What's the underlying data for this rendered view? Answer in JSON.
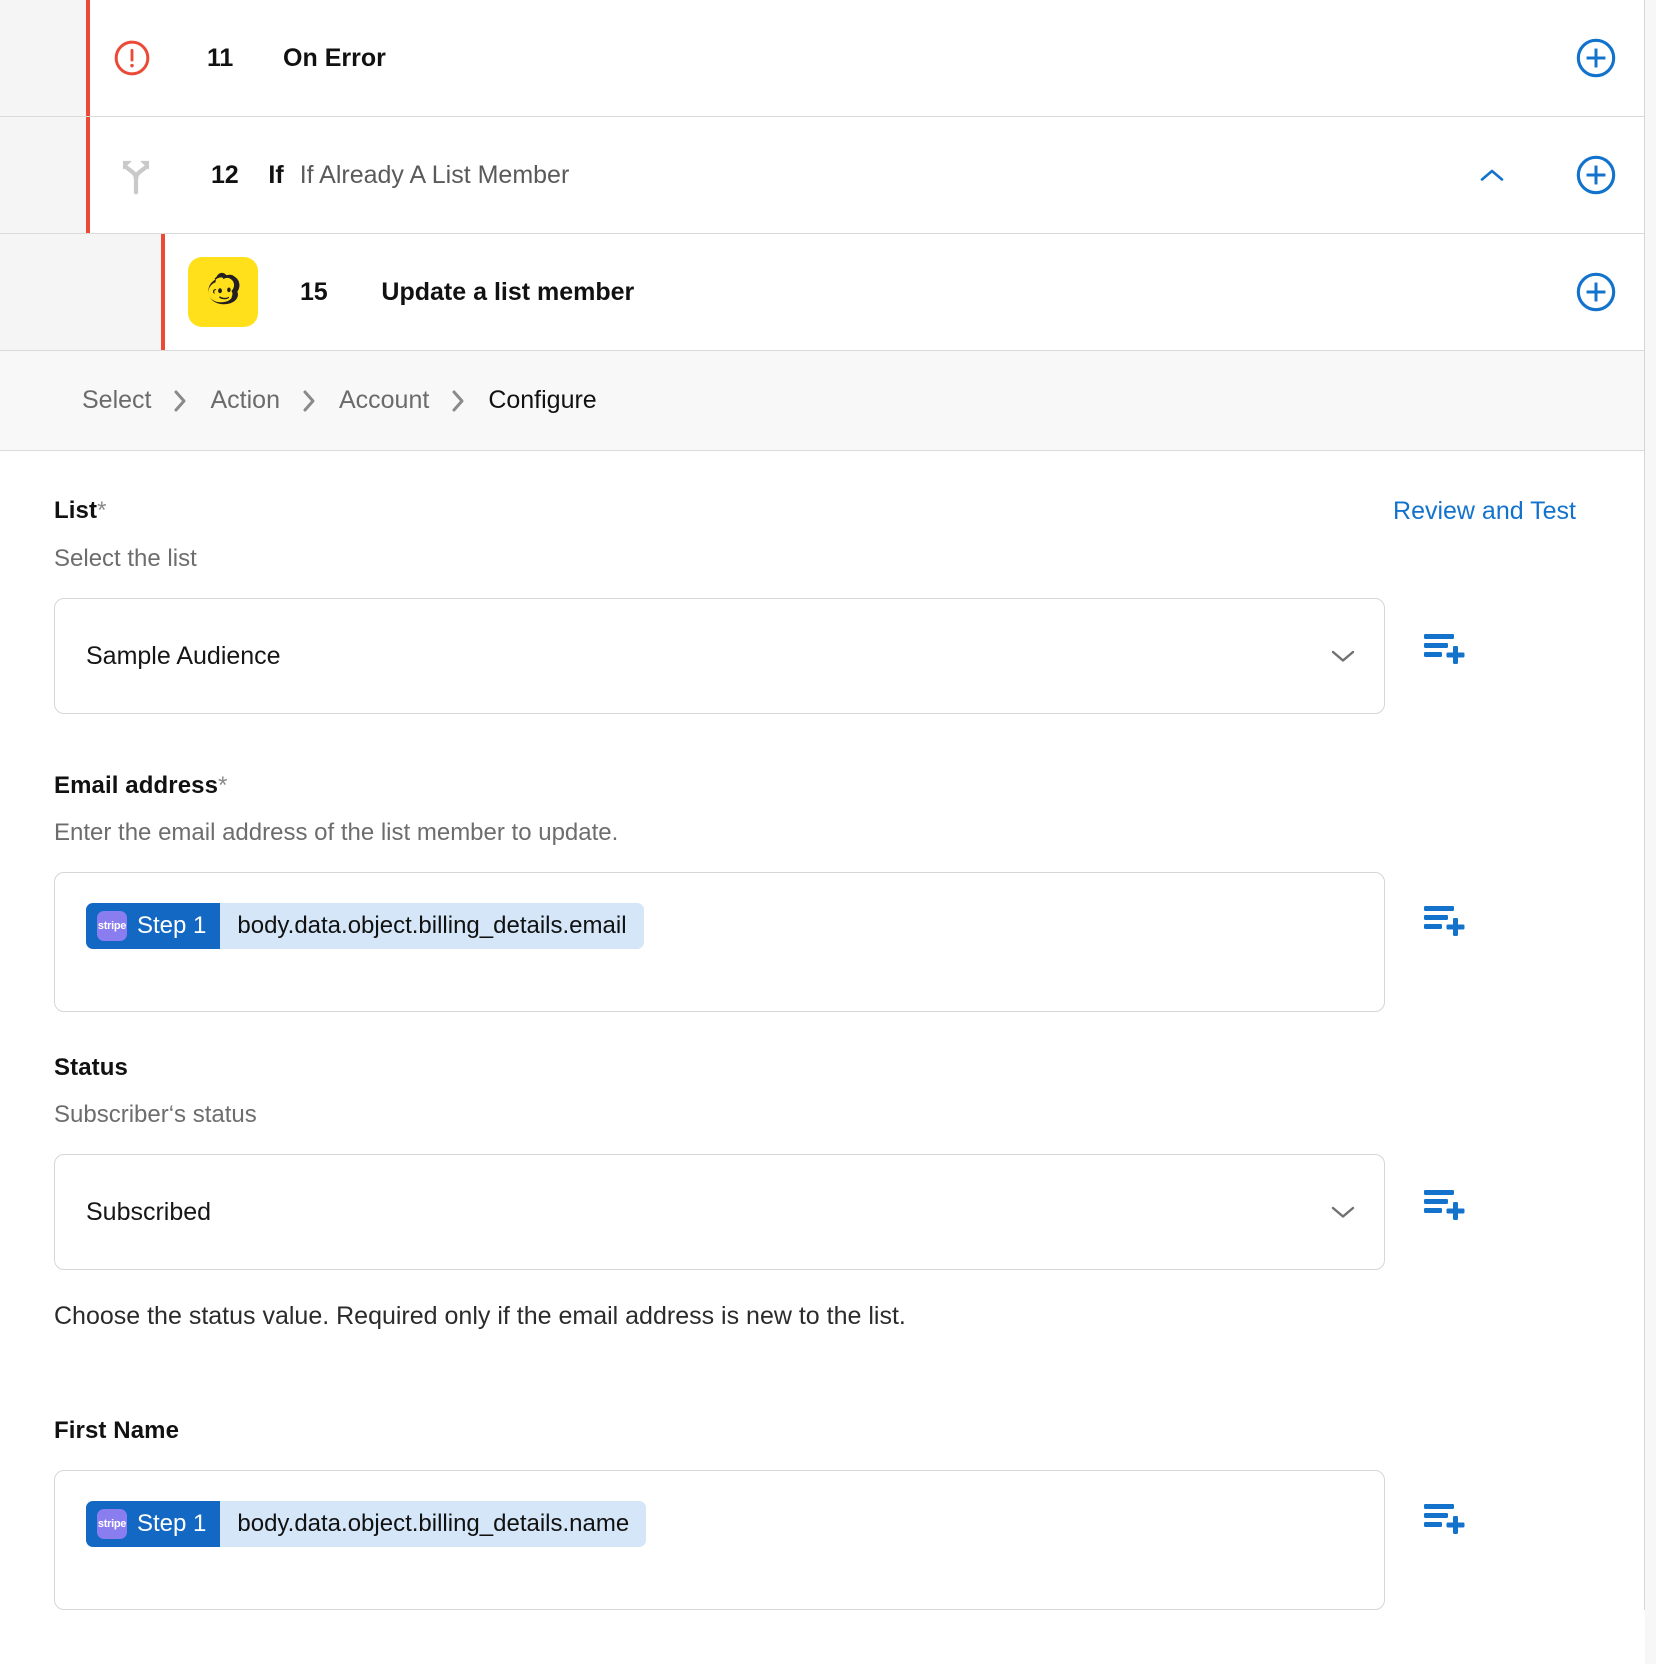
{
  "workflow": {
    "steps": [
      {
        "number": "11",
        "kind": "",
        "title": "On Error",
        "icon": "error-circle-icon",
        "add_icon": "plus-circle-icon"
      },
      {
        "number": "12",
        "kind": "If",
        "title": "If Already A List Member",
        "icon": "branch-icon",
        "collapse_icon": "chevron-up-icon",
        "add_icon": "plus-circle-icon"
      },
      {
        "number": "15",
        "kind": "",
        "title": "Update a list member",
        "icon": "mailchimp-icon",
        "add_icon": "plus-circle-icon"
      }
    ]
  },
  "breadcrumb": {
    "items": [
      "Select",
      "Action",
      "Account",
      "Configure"
    ],
    "current": "Configure",
    "separator_icon": "chevron-right-icon"
  },
  "actions": {
    "review_and_test": "Review and Test",
    "add_field_icon": "add-to-list-icon"
  },
  "fields": [
    {
      "label": "List",
      "required": true,
      "description": "Select the list",
      "control": "select",
      "value": "Sample Audience",
      "caret_icon": "chevron-down-icon"
    },
    {
      "label": "Email address",
      "required": true,
      "description": "Enter the email address of the list member to update.",
      "control": "token",
      "token": {
        "app": "stripe",
        "step": "Step 1",
        "path": "body.data.object.billing_details.email"
      }
    },
    {
      "label": "Status",
      "required": false,
      "description": "Subscriber‘s status",
      "control": "select",
      "value": "Subscribed",
      "caret_icon": "chevron-down-icon",
      "helper": "Choose the status value. Required only if the email address is new to the list."
    },
    {
      "label": "First Name",
      "required": false,
      "description": "",
      "control": "token",
      "token": {
        "app": "stripe",
        "step": "Step 1",
        "path": "body.data.object.billing_details.name"
      }
    }
  ],
  "colors": {
    "accent_blue": "#1373cc",
    "token_blue": "#1268c3",
    "token_path_bg": "#d4e6f7",
    "stripe_purple": "#8a7df0",
    "error_red": "#eb4b36",
    "mailchimp_yellow": "#ffe01b",
    "gutter_gray": "#f5f5f5"
  }
}
